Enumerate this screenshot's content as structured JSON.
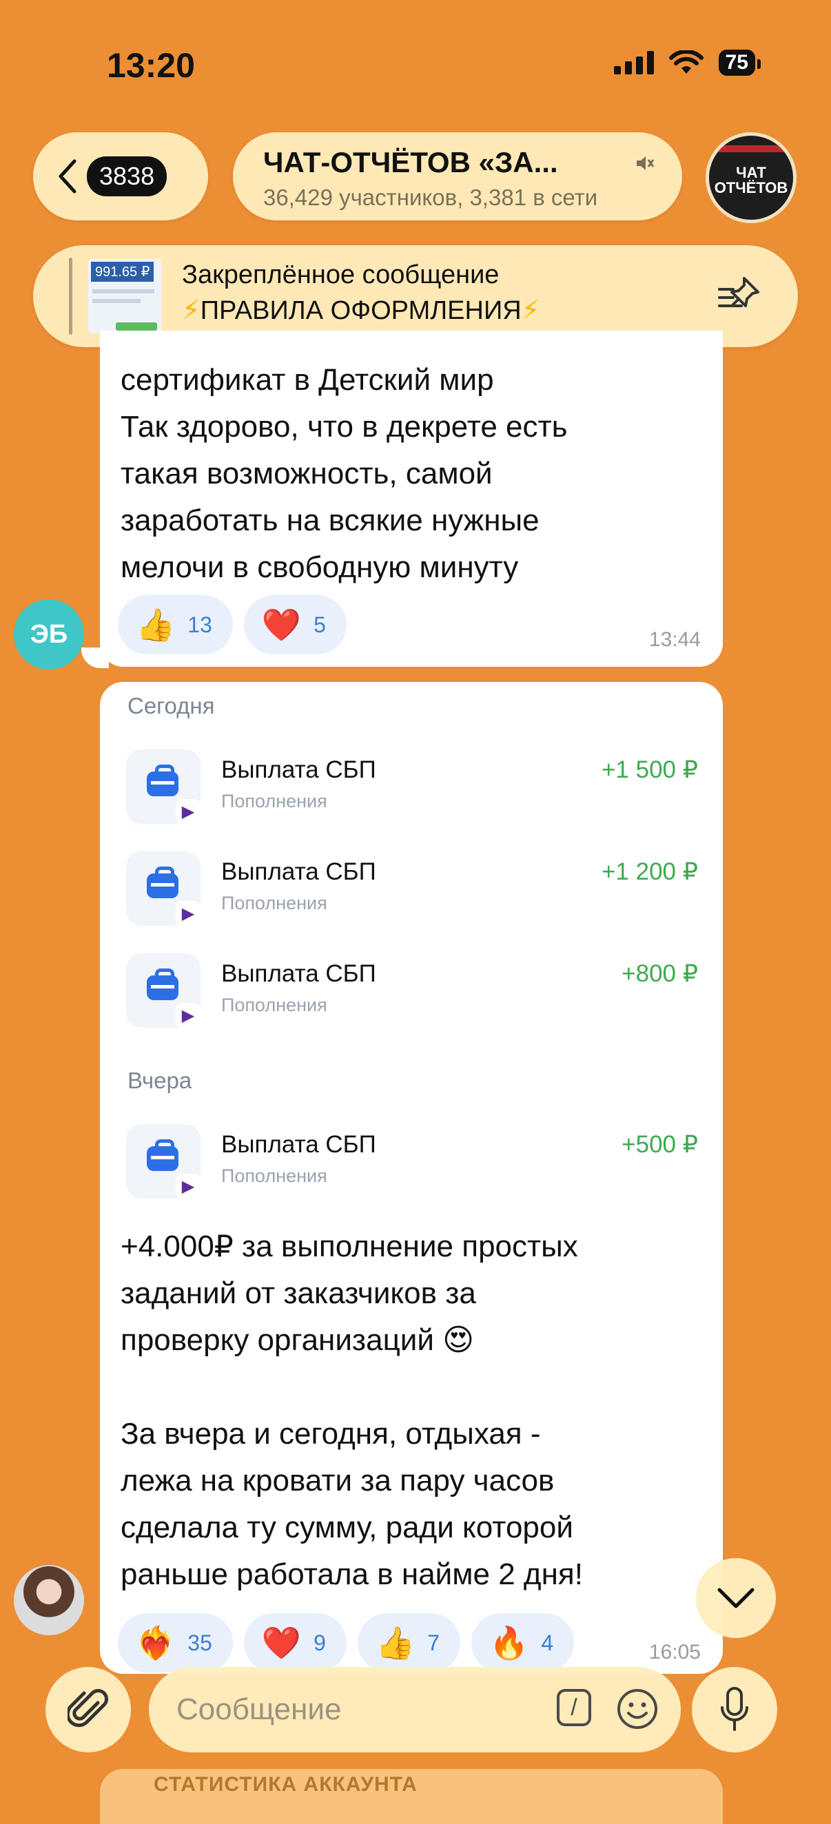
{
  "status_bar": {
    "time": "13:20",
    "battery": "75"
  },
  "header": {
    "back_count": "3838",
    "title": "ЧАТ-ОТЧЁТОВ «ЗА...",
    "subtitle": "36,429 участников, 3,381 в сети",
    "avatar_text": "ЧАТ ОТЧЁТОВ"
  },
  "pinned": {
    "label": "Закреплённое сообщение",
    "text": "ПРАВИЛА ОФОРМЛЕНИЯ",
    "thumb_value": "991.65 ₽"
  },
  "message1": {
    "author_initials": "ЭБ",
    "lines": [
      "сертификат в Детский мир",
      "Так здорово, что в декрете есть",
      "такая возможность, самой",
      "заработать на всякие нужные",
      "мелочи в свободную минуту"
    ],
    "reactions": [
      {
        "emoji": "👍",
        "count": "13"
      },
      {
        "emoji": "❤️",
        "count": "5"
      }
    ],
    "time": "13:44"
  },
  "message2": {
    "today_label": "Сегодня",
    "yesterday_label": "Вчера",
    "transactions_today": [
      {
        "name": "Выплата СБП",
        "category": "Пополнения",
        "amount": "+1 500 ₽"
      },
      {
        "name": "Выплата СБП",
        "category": "Пополнения",
        "amount": "+1 200 ₽"
      },
      {
        "name": "Выплата СБП",
        "category": "Пополнения",
        "amount": "+800 ₽"
      }
    ],
    "transactions_yesterday": [
      {
        "name": "Выплата СБП",
        "category": "Пополнения",
        "amount": "+500 ₽"
      }
    ],
    "lines": [
      "+4.000₽ за выполнение простых",
      "заданий от заказчиков за",
      "проверку организаций 😍",
      "",
      "За вчера и сегодня, отдыхая -",
      "лежа на кровати за пару часов",
      "сделала ту сумму, ради которой",
      "раньше работала в найме 2 дня!"
    ],
    "reactions": [
      {
        "emoji": "❤️‍🔥",
        "count": "35"
      },
      {
        "emoji": "❤️",
        "count": "9"
      },
      {
        "emoji": "👍",
        "count": "7"
      },
      {
        "emoji": "🔥",
        "count": "4"
      }
    ],
    "time": "16:05"
  },
  "composer": {
    "placeholder": "Сообщение"
  },
  "next_preview": {
    "text": "СТАТИСТИКА АККАУНТА"
  },
  "colors": {
    "background": "#ec8e34",
    "accent_green": "#3daa4e",
    "reaction_blue": "#3d7cd6"
  }
}
